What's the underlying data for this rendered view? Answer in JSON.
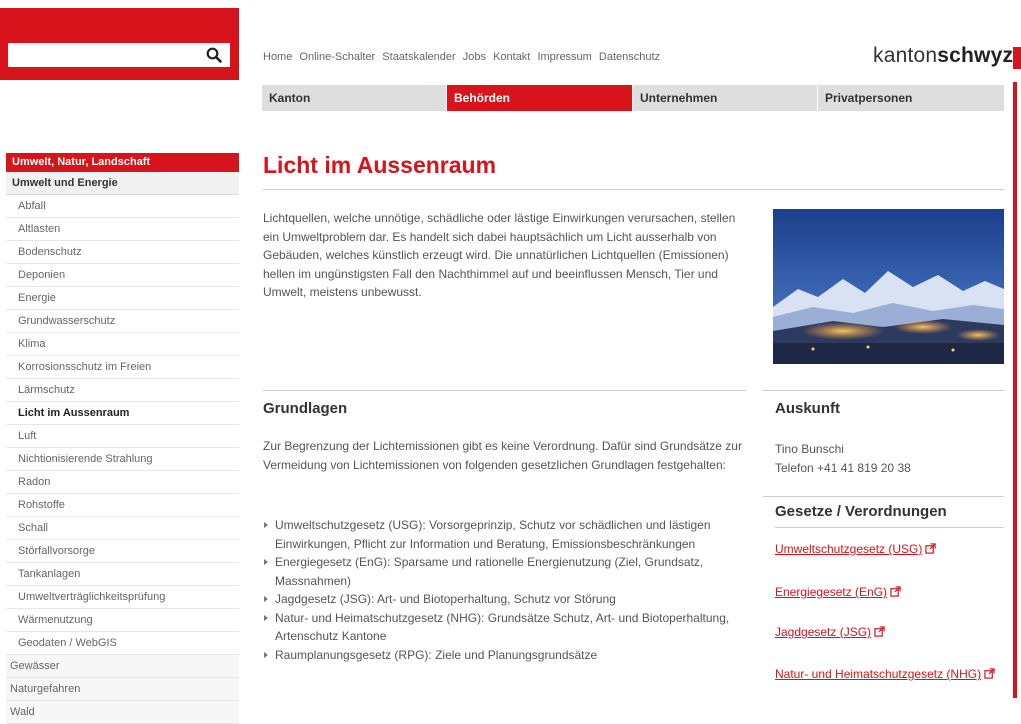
{
  "search": {
    "placeholder": ""
  },
  "top_links": [
    "Home",
    "Online-Schalter",
    "Staatskalender",
    "Jobs",
    "Kontakt",
    "Impressum",
    "Datenschutz"
  ],
  "brand": {
    "light": "kanton",
    "bold": "schwyz"
  },
  "main_nav": [
    {
      "label": "Kanton",
      "active": false
    },
    {
      "label": "Behörden",
      "active": true
    },
    {
      "label": "Unternehmen",
      "active": false
    },
    {
      "label": "Privatpersonen",
      "active": false
    }
  ],
  "sidebar": {
    "section": "Umwelt, Natur, Landschaft",
    "parent": "Umwelt und Energie",
    "items": [
      {
        "label": "Abfall",
        "current": false
      },
      {
        "label": "Altlasten",
        "current": false
      },
      {
        "label": "Bodenschutz",
        "current": false
      },
      {
        "label": "Deponien",
        "current": false
      },
      {
        "label": "Energie",
        "current": false
      },
      {
        "label": "Grundwasserschutz",
        "current": false
      },
      {
        "label": "Klima",
        "current": false
      },
      {
        "label": "Korrosionsschutz im Freien",
        "current": false
      },
      {
        "label": "Lärmschutz",
        "current": false
      },
      {
        "label": "Licht im Aussenraum",
        "current": true
      },
      {
        "label": "Luft",
        "current": false
      },
      {
        "label": "Nichtionisierende Strahlung",
        "current": false
      },
      {
        "label": "Radon",
        "current": false
      },
      {
        "label": "Rohstoffe",
        "current": false
      },
      {
        "label": "Schall",
        "current": false
      },
      {
        "label": "Störfallvorsorge",
        "current": false
      },
      {
        "label": "Tankanlagen",
        "current": false
      },
      {
        "label": "Umweltverträglichkeitsprüfung",
        "current": false
      },
      {
        "label": "Wärmenutzung",
        "current": false
      },
      {
        "label": "Geodaten / WebGIS",
        "current": false
      }
    ],
    "top_items": [
      "Gewässer",
      "Naturgefahren",
      "Wald"
    ]
  },
  "page": {
    "title": "Licht im Aussenraum",
    "intro": "Lichtquellen, welche unnötige, schädliche oder lästige Einwirkungen verursachen, stellen ein Umweltproblem dar. Es handelt sich dabei hauptsächlich um Licht ausserhalb von Gebäuden, welches künstlich erzeugt wird. Die unnatürlichen Lichtquellen (Emissionen) hellen im ungünstigsten Fall den Nachthimmel auf und beeinflussen Mensch, Tier und Umwelt, meistens unbewusst."
  },
  "grundlagen": {
    "heading": "Grundlagen",
    "text": "Zur Begrenzung der Lichtemissionen gibt es keine Verordnung. Dafür sind Grundsätze zur Vermeidung von Lichtemissionen von folgenden gesetzlichen Grundlagen festgehalten:",
    "bullets": [
      "Umweltschutzgesetz (USG): Vorsorgeprinzip, Schutz vor schädlichen und lästigen Einwirkungen, Pflicht zur Information und Beratung, Emissionsbeschränkungen",
      "Energiegesetz (EnG): Sparsame und rationelle Energienutzung (Ziel, Grundsatz, Massnahmen)",
      "Jagdgesetz (JSG): Art- und Biotoperhaltung, Schutz vor Störung",
      "Natur- und Heimatschutzgesetz (NHG): Grundsätze Schutz, Art- und Biotoperhaltung, Artenschutz Kantone",
      "Raumplanungsgesetz (RPG): Ziele und Planungsgrundsätze"
    ]
  },
  "auskunft": {
    "heading": "Auskunft",
    "name": "Tino Bunschi",
    "phone": "Telefon +41 41 819 20 38"
  },
  "gesetze": {
    "heading": "Gesetze / Verordnungen",
    "links": [
      "Umweltschutzgesetz (USG)",
      "Energiegesetz (EnG)",
      "Jagdgesetz (JSG)",
      "Natur- und Heimatschutzgesetz (NHG)"
    ]
  },
  "colors": {
    "accent": "#d7131b",
    "nav_bg": "#dedede",
    "text": "#555555"
  },
  "icons": {
    "search": "magnifier-icon",
    "external_link": "external-link-icon"
  }
}
